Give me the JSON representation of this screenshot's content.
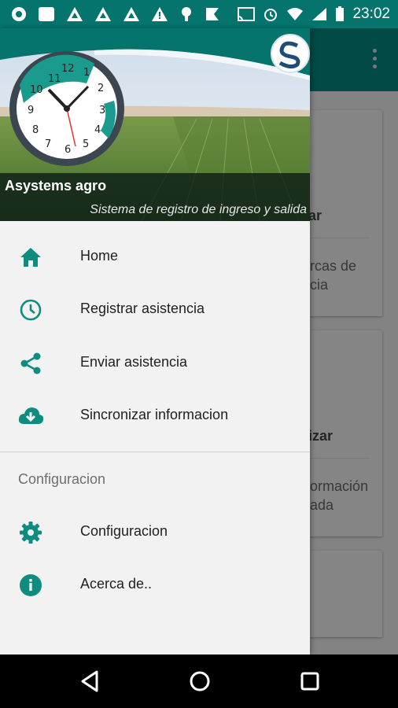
{
  "status_bar": {
    "time": "23:02",
    "icons": [
      "aperture-icon",
      "image-icon",
      "alert-triangle-icon",
      "alert-triangle-icon",
      "alert-triangle-icon",
      "warning-icon",
      "android-icon",
      "flag-icon",
      "cast-icon",
      "alarm-icon",
      "wifi-icon",
      "battery-icon"
    ]
  },
  "header": {
    "app_name": "Asystems agro",
    "subtitle": "Sistema de registro de ingreso y salida",
    "clock_numbers": [
      "11",
      "12",
      "1",
      "10",
      "2",
      "9",
      "3",
      "8",
      "4",
      "7",
      "6",
      "5"
    ]
  },
  "menu": [
    {
      "label": "Home",
      "icon": "home-icon"
    },
    {
      "label": "Registrar asistencia",
      "icon": "clock-icon"
    },
    {
      "label": "Enviar asistencia",
      "icon": "share-icon"
    },
    {
      "label": "Sincronizar informacion",
      "icon": "cloud-download-icon"
    }
  ],
  "section": {
    "title": "Configuracion",
    "items": [
      {
        "label": "Configuracion",
        "icon": "gear-icon"
      },
      {
        "label": "Acerca de..",
        "icon": "info-icon"
      }
    ]
  },
  "background_app": {
    "card1_title": "ar",
    "card1_line1": "rcas de",
    "card1_line2": "cia",
    "card2_title": "izar",
    "card2_line1": "ormación",
    "card2_line2": "ada"
  },
  "colors": {
    "primary": "#05887f",
    "primary_dark": "#04746c",
    "icon_tint": "#0e8c80"
  }
}
